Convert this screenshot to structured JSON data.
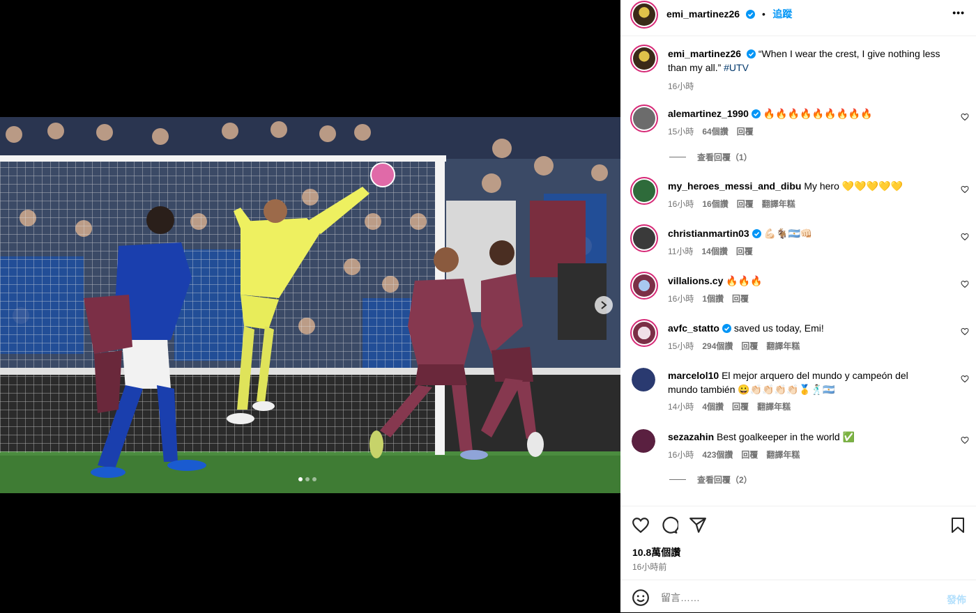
{
  "post": {
    "username": "emi_martinez26",
    "follow_label": "追蹤",
    "more_label": "•••",
    "caption_text": "“When I wear the crest, I give nothing less than my all.”",
    "caption_hashtag": "#UTV",
    "caption_time": "16小時",
    "likes": "10.8萬個讚",
    "posted": "16小時前",
    "comment_placeholder": "留言……",
    "post_button": "發佈"
  },
  "comments": [
    {
      "user": "alemartinez_1990",
      "verified": true,
      "text": "🔥🔥🔥🔥🔥🔥🔥🔥🔥",
      "time": "15小時",
      "likes": "64個讚",
      "reply": "回覆",
      "translate": "",
      "view_replies": "查看回覆（1）"
    },
    {
      "user": "my_heroes_messi_and_dibu",
      "verified": false,
      "text": "My hero 💛💛💛💛💛",
      "time": "16小時",
      "likes": "16個讚",
      "reply": "回覆",
      "translate": "翻譯年糕",
      "view_replies": ""
    },
    {
      "user": "christianmartin03",
      "verified": true,
      "text": "💪🏻🐐🇦🇷👊🏻",
      "time": "11小時",
      "likes": "14個讚",
      "reply": "回覆",
      "translate": "",
      "view_replies": ""
    },
    {
      "user": "villalions.cy",
      "verified": false,
      "text": "🔥🔥🔥",
      "time": "16小時",
      "likes": "1個讚",
      "reply": "回覆",
      "translate": "",
      "view_replies": ""
    },
    {
      "user": "avfc_statto",
      "verified": true,
      "text": "saved us today, Emi!",
      "time": "15小時",
      "likes": "294個讚",
      "reply": "回覆",
      "translate": "翻譯年糕",
      "view_replies": ""
    },
    {
      "user": "marcelol10",
      "verified": false,
      "text": "El mejor arquero del mundo y campeón del mundo también 😀👏🏻👏🏻👏🏻👏🏻🥇🕺🏻🇦🇷",
      "time": "14小時",
      "likes": "4個讚",
      "reply": "回覆",
      "translate": "翻譯年糕",
      "view_replies": ""
    },
    {
      "user": "sezazahin",
      "verified": false,
      "text": "Best goalkeeper in the world ✅",
      "time": "16小時",
      "likes": "423個讚",
      "reply": "回覆",
      "translate": "翻譯年糕",
      "view_replies": "查看回覆（2）"
    }
  ],
  "carousel": {
    "count": 3,
    "active": 1
  }
}
